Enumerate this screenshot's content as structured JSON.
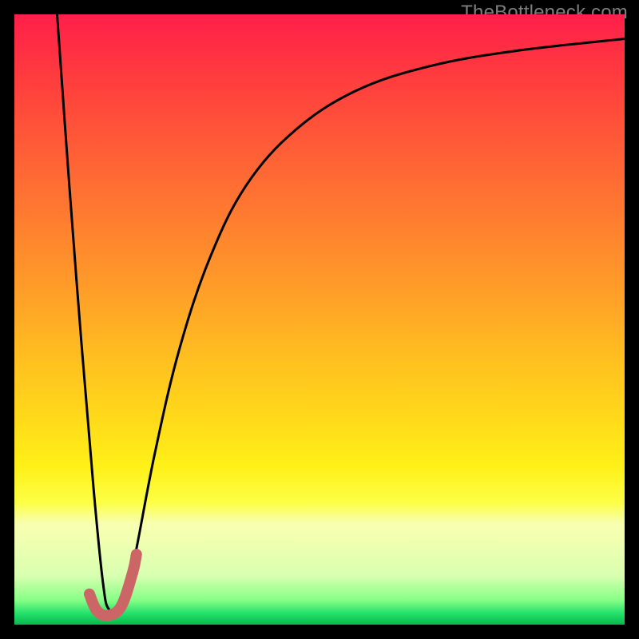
{
  "watermark": "TheBottleneck.com",
  "chart_data": {
    "type": "line",
    "title": "",
    "xlabel": "",
    "ylabel": "",
    "xlim": [
      0,
      100
    ],
    "ylim": [
      0,
      100
    ],
    "grid": false,
    "gradient_stops": [
      {
        "pos": 0,
        "color": "#ff1f4a"
      },
      {
        "pos": 10,
        "color": "#ff3b3e"
      },
      {
        "pos": 22,
        "color": "#ff5d37"
      },
      {
        "pos": 34,
        "color": "#ff7e2f"
      },
      {
        "pos": 46,
        "color": "#ffa028"
      },
      {
        "pos": 56,
        "color": "#ffbe20"
      },
      {
        "pos": 66,
        "color": "#ffd91a"
      },
      {
        "pos": 74,
        "color": "#fff018"
      },
      {
        "pos": 80,
        "color": "#fcff45"
      },
      {
        "pos": 84,
        "color": "#f7ffb0"
      },
      {
        "pos": 92,
        "color": "#d8ffb0"
      },
      {
        "pos": 96,
        "color": "#86ff86"
      },
      {
        "pos": 98,
        "color": "#22e06a"
      },
      {
        "pos": 100,
        "color": "#0ab74e"
      }
    ],
    "series": [
      {
        "name": "thin-black-curve",
        "stroke": "#000000",
        "stroke_width": 3,
        "points": [
          {
            "x": 7.0,
            "y": 100.0
          },
          {
            "x": 9.0,
            "y": 72.0
          },
          {
            "x": 11.0,
            "y": 46.0
          },
          {
            "x": 13.0,
            "y": 22.0
          },
          {
            "x": 14.5,
            "y": 7.0
          },
          {
            "x": 15.5,
            "y": 2.5
          },
          {
            "x": 17.5,
            "y": 3.0
          },
          {
            "x": 19.5,
            "y": 10.0
          },
          {
            "x": 23.0,
            "y": 28.0
          },
          {
            "x": 27.0,
            "y": 45.0
          },
          {
            "x": 32.0,
            "y": 60.0
          },
          {
            "x": 38.0,
            "y": 72.0
          },
          {
            "x": 46.0,
            "y": 81.0
          },
          {
            "x": 56.0,
            "y": 87.5
          },
          {
            "x": 68.0,
            "y": 91.5
          },
          {
            "x": 82.0,
            "y": 94.0
          },
          {
            "x": 100.0,
            "y": 96.0
          }
        ]
      },
      {
        "name": "thick-red-hook",
        "stroke": "#cc6666",
        "stroke_width": 14,
        "linecap": "round",
        "points": [
          {
            "x": 12.3,
            "y": 5.0
          },
          {
            "x": 13.5,
            "y": 2.3
          },
          {
            "x": 15.3,
            "y": 1.5
          },
          {
            "x": 17.5,
            "y": 3.0
          },
          {
            "x": 19.4,
            "y": 8.6
          },
          {
            "x": 20.0,
            "y": 11.5
          }
        ]
      }
    ]
  }
}
